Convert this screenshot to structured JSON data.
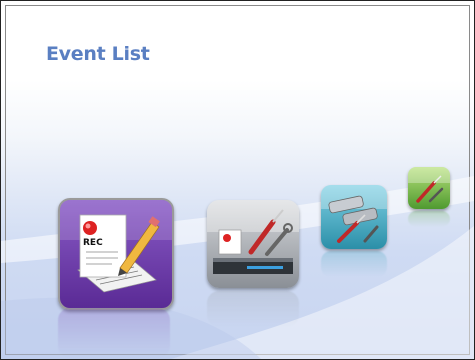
{
  "screen": {
    "title": "Event List"
  },
  "menu": {
    "items": [
      {
        "id": "event-list",
        "icon": "event-list-icon",
        "label_icon_text": "REC",
        "selected": true
      },
      {
        "id": "record-setup",
        "icon": "record-setup-tools-icon",
        "selected": false
      },
      {
        "id": "camera-setup",
        "icon": "camera-setup-icon",
        "selected": false
      },
      {
        "id": "system-setup",
        "icon": "system-tools-icon",
        "selected": false
      }
    ]
  },
  "colors": {
    "title": "#5a7fc2",
    "selected_tile": "#6a3aa0",
    "tile_gray": "#8a8f96",
    "tile_teal": "#2b8fa8",
    "tile_green": "#5aa83a"
  }
}
